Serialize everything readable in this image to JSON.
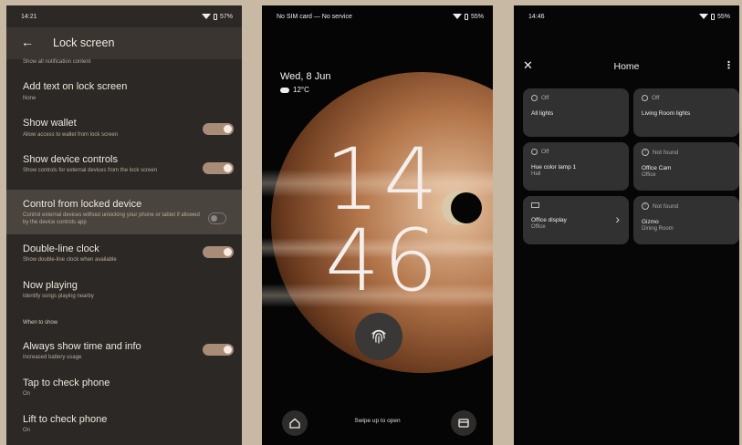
{
  "phone1": {
    "status": {
      "time": "14:21",
      "battery": "57%"
    },
    "title": "Lock screen",
    "cut_top": "Show all notification content",
    "rows": [
      {
        "title": "Add text on lock screen",
        "sub": "None"
      },
      {
        "title": "Show wallet",
        "sub": "Allow access to wallet from lock screen"
      },
      {
        "title": "Show device controls",
        "sub": "Show controls for external devices from the lock screen"
      },
      {
        "title": "Control from locked device",
        "sub": "Control external devices without unlocking your phone or tablet if allowed by the device controls app"
      },
      {
        "title": "Double-line clock",
        "sub": "Show double-line clock when available"
      },
      {
        "title": "Now playing",
        "sub": "Identify songs playing nearby"
      },
      {
        "title": "Always show time and info",
        "sub": "Increased battery usage"
      },
      {
        "title": "Tap to check phone",
        "sub": "On"
      },
      {
        "title": "Lift to check phone",
        "sub": "On"
      }
    ],
    "section_header": "When to show"
  },
  "phone2": {
    "status": {
      "left": "No SIM card — No service",
      "battery": "55%"
    },
    "date": "Wed, 8 Jun",
    "weather": "12°C",
    "clock_hour": "14",
    "clock_min": "46",
    "swipe": "Swipe up to open"
  },
  "phone3": {
    "status": {
      "time": "14:46",
      "battery": "55%"
    },
    "title": "Home",
    "tiles": [
      {
        "status": "Off",
        "name": "All lights",
        "room": ""
      },
      {
        "status": "Off",
        "name": "Living Room lights",
        "room": ""
      },
      {
        "status": "Off",
        "name": "Hue color lamp 1",
        "room": "Hall"
      },
      {
        "status": "Not found",
        "name": "Office Cam",
        "room": "Office"
      },
      {
        "status": "",
        "name": "Office display",
        "room": "Office"
      },
      {
        "status": "Not found",
        "name": "Gizmo",
        "room": "Dining Room"
      }
    ]
  }
}
